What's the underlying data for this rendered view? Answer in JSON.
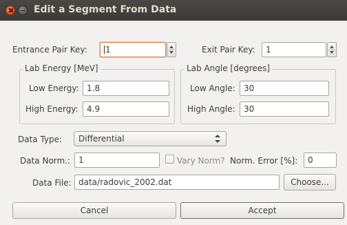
{
  "window": {
    "title": "Edit a Segment From Data"
  },
  "entrance_pair": {
    "label": "Entrance Pair Key:",
    "value": "1"
  },
  "exit_pair": {
    "label": "Exit Pair Key:",
    "value": "1"
  },
  "lab_energy": {
    "group_title": "Lab Energy [MeV]",
    "low_label": "Low Energy:",
    "low_value": "1.8",
    "high_label": "High Energy:",
    "high_value": "4.9"
  },
  "lab_angle": {
    "group_title": "Lab Angle [degrees]",
    "low_label": "Low Angle:",
    "low_value": "30",
    "high_label": "High Angle:",
    "high_value": "30"
  },
  "data_type": {
    "label": "Data Type:",
    "selected": "Differential"
  },
  "data_norm": {
    "label": "Data Norm.:",
    "value": "1"
  },
  "vary_norm": {
    "label": "Vary Norm?",
    "checked": false
  },
  "norm_error": {
    "label": "Norm. Error [%]:",
    "value": "0"
  },
  "data_file": {
    "label": "Data File:",
    "value": "data/radovic_2002.dat",
    "choose_label": "Choose..."
  },
  "buttons": {
    "cancel": "Cancel",
    "accept": "Accept"
  },
  "colors": {
    "titlebar": "#3c3b37",
    "close_button": "#e95420",
    "focus": "#e07a45",
    "background": "#f2f1f0"
  }
}
